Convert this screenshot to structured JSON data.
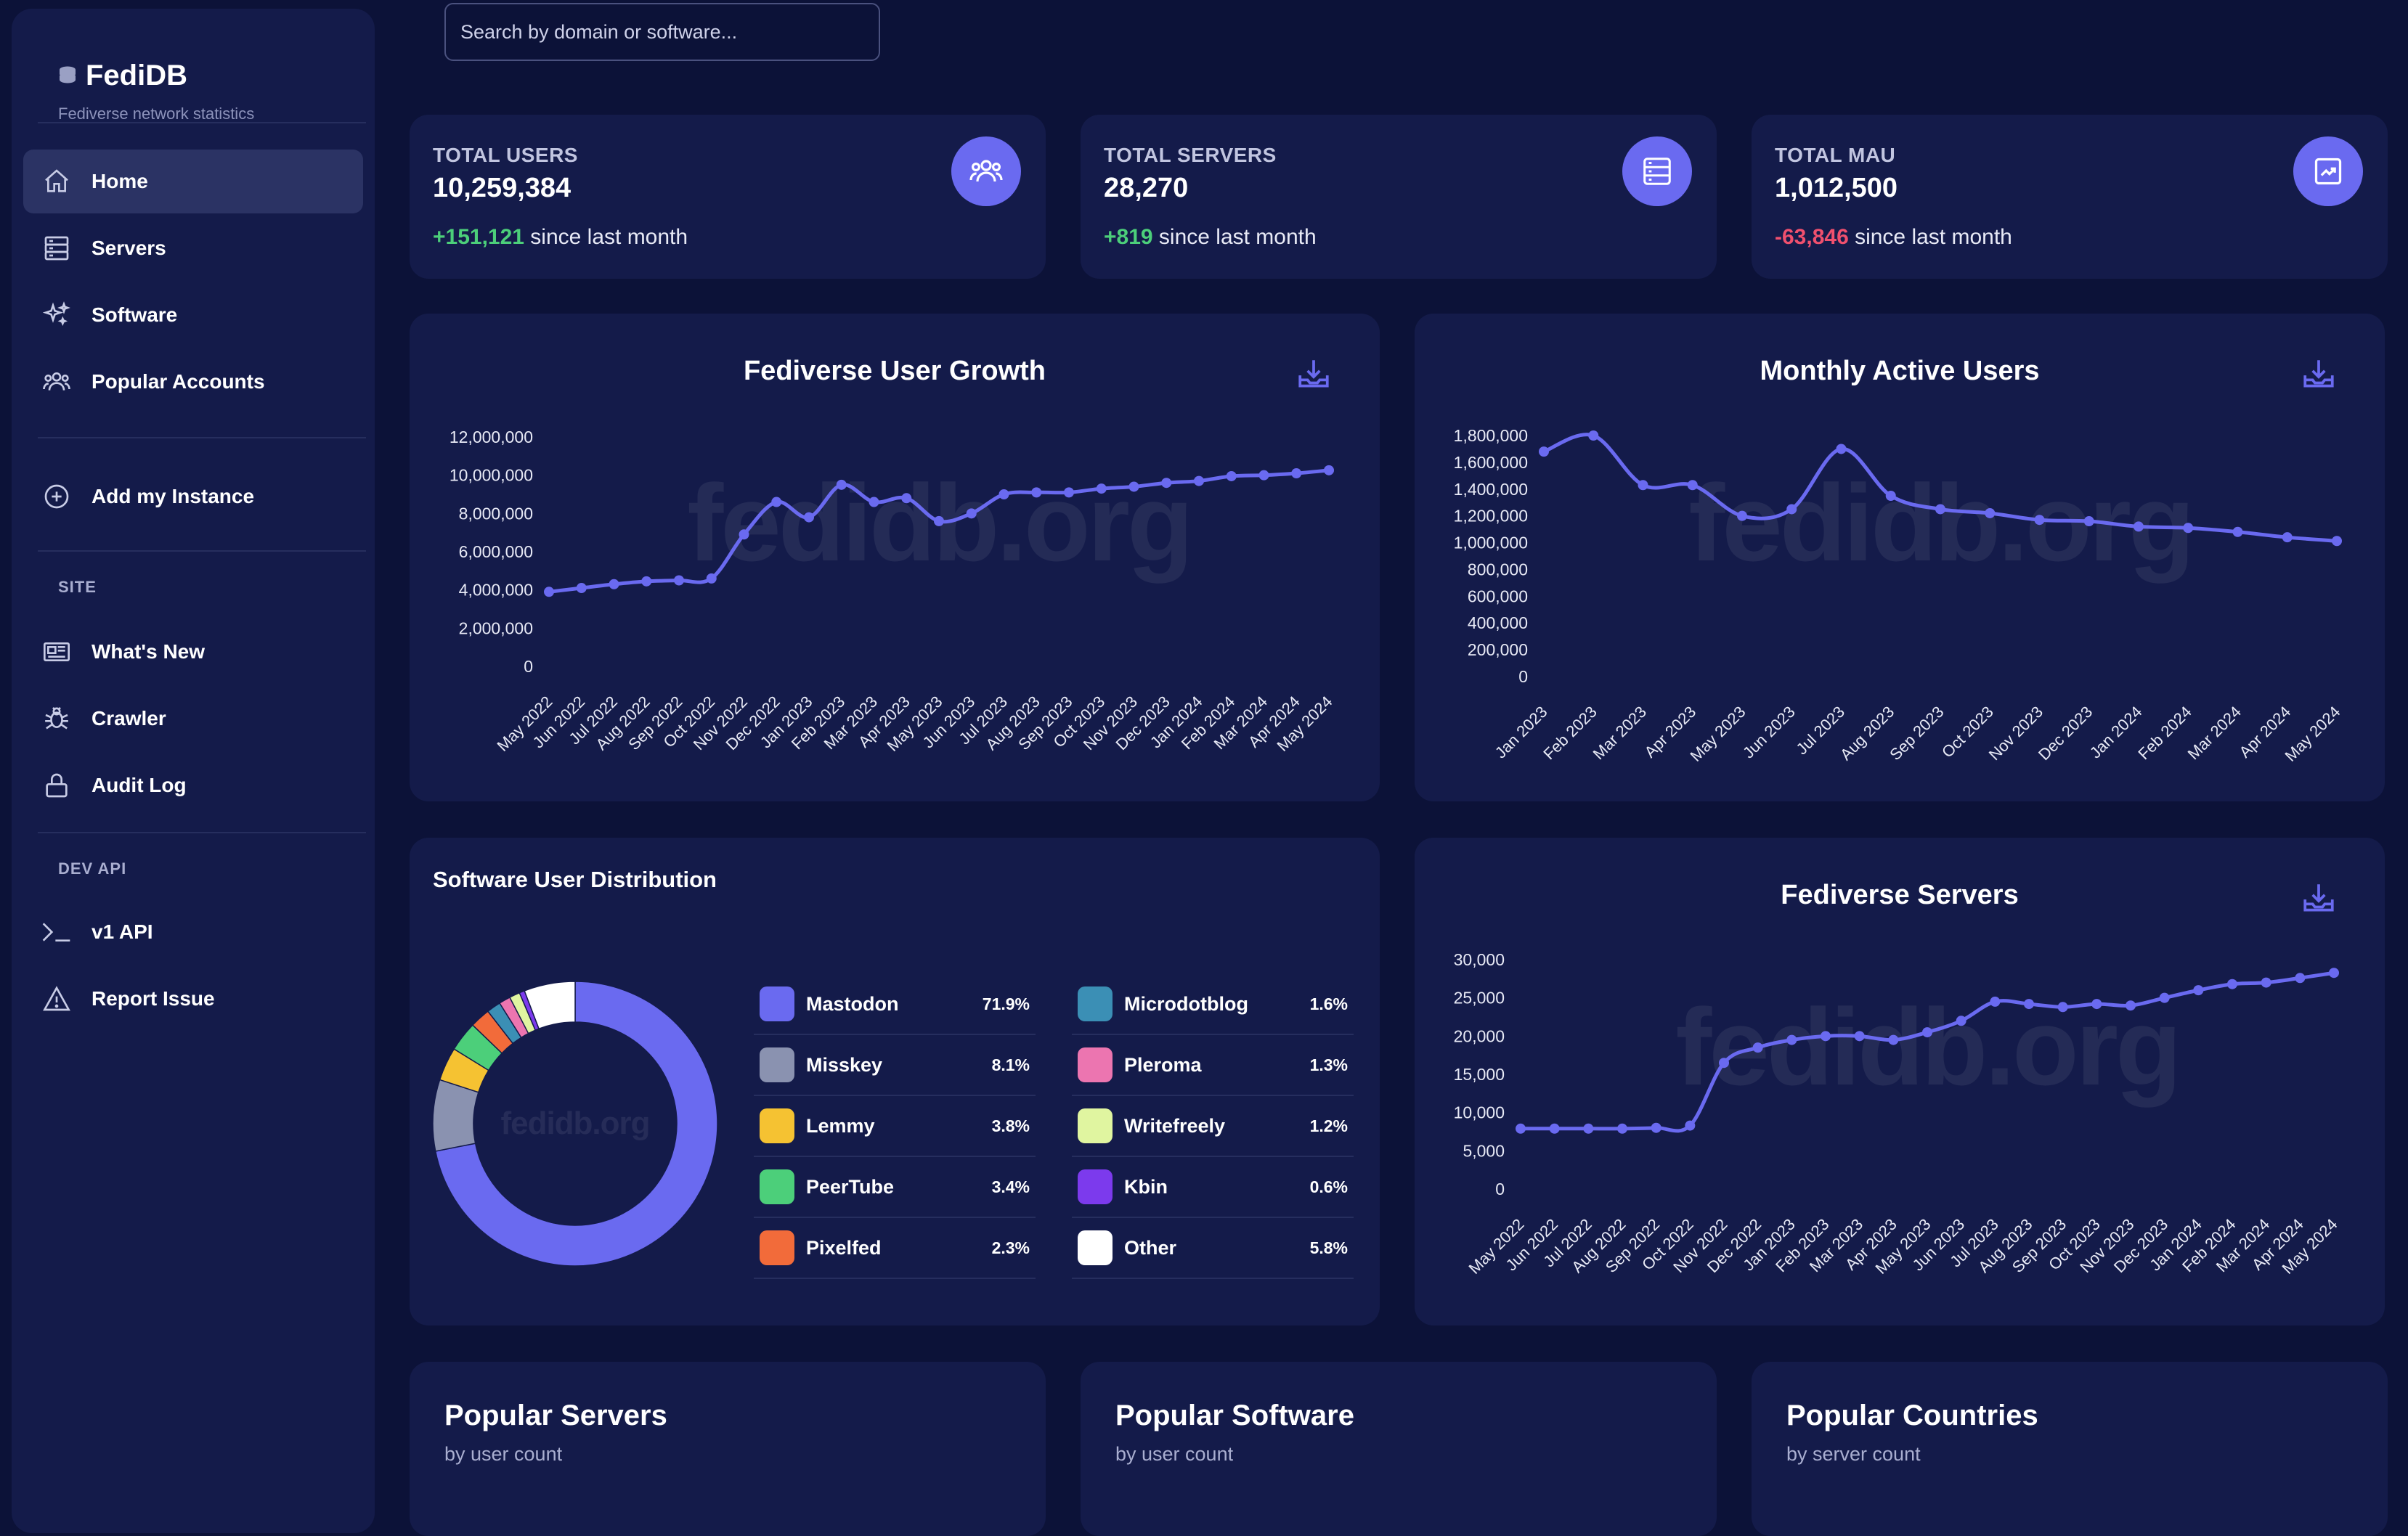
{
  "sidebar": {
    "brand": "FediDB",
    "tagline": "Fediverse network statistics",
    "nav": [
      {
        "label": "Home",
        "icon": "home-icon"
      },
      {
        "label": "Servers",
        "icon": "servers-icon"
      },
      {
        "label": "Software",
        "icon": "sparkles-icon"
      },
      {
        "label": "Popular Accounts",
        "icon": "users-icon"
      }
    ],
    "add_instance": "Add my Instance",
    "site_label": "SITE",
    "site_items": [
      {
        "label": "What's New",
        "icon": "newspaper-icon"
      },
      {
        "label": "Crawler",
        "icon": "bug-icon"
      },
      {
        "label": "Audit Log",
        "icon": "lock-icon"
      }
    ],
    "dev_label": "DEV API",
    "dev_items": [
      {
        "label": "v1 API",
        "icon": "terminal-icon"
      },
      {
        "label": "Report Issue",
        "icon": "warning-icon"
      }
    ]
  },
  "search": {
    "placeholder": "Search by domain or software..."
  },
  "stats": [
    {
      "label": "TOTAL USERS",
      "value": "10,259,384",
      "change": "+151,121",
      "suffix": " since last month",
      "icon": "users-icon"
    },
    {
      "label": "TOTAL SERVERS",
      "value": "28,270",
      "change": "+819",
      "suffix": " since last month",
      "icon": "server-icon"
    },
    {
      "label": "TOTAL MAU",
      "value": "1,012,500",
      "change": "-63,846",
      "suffix": " since last month",
      "icon": "trend-icon"
    }
  ],
  "colors": {
    "accent": "#6a6af0",
    "positive": "#4ccf7a",
    "negative": "#f0506e"
  },
  "watermark": "fedidb.org",
  "chart_data": [
    {
      "type": "line",
      "title": "Fediverse User Growth",
      "x": [
        "May 2022",
        "Jun 2022",
        "Jul 2022",
        "Aug 2022",
        "Sep 2022",
        "Oct 2022",
        "Nov 2022",
        "Dec 2022",
        "Jan 2023",
        "Feb 2023",
        "Mar 2023",
        "Apr 2023",
        "May 2023",
        "Jun 2023",
        "Jul 2023",
        "Aug 2023",
        "Sep 2023",
        "Oct 2023",
        "Nov 2023",
        "Dec 2023",
        "Jan 2024",
        "Feb 2024",
        "Mar 2024",
        "Apr 2024",
        "May 2024"
      ],
      "values": [
        3900000,
        4100000,
        4300000,
        4450000,
        4500000,
        4600000,
        6900000,
        8600000,
        7800000,
        9500000,
        8600000,
        8800000,
        7600000,
        8000000,
        9000000,
        9100000,
        9100000,
        9300000,
        9400000,
        9600000,
        9700000,
        9950000,
        10000000,
        10100000,
        10259384
      ],
      "yticks": [
        "0",
        "2,000,000",
        "4,000,000",
        "6,000,000",
        "8,000,000",
        "10,000,000",
        "12,000,000"
      ],
      "ylim": [
        0,
        12000000
      ],
      "grid": false
    },
    {
      "type": "line",
      "title": "Monthly Active Users",
      "x": [
        "Jan 2023",
        "Feb 2023",
        "Mar 2023",
        "Apr 2023",
        "May 2023",
        "Jun 2023",
        "Jul 2023",
        "Aug 2023",
        "Sep 2023",
        "Oct 2023",
        "Nov 2023",
        "Dec 2023",
        "Jan 2024",
        "Feb 2024",
        "Mar 2024",
        "Apr 2024",
        "May 2024"
      ],
      "values": [
        1680000,
        1800000,
        1430000,
        1430000,
        1200000,
        1250000,
        1700000,
        1350000,
        1250000,
        1220000,
        1170000,
        1160000,
        1120000,
        1110000,
        1080000,
        1040000,
        1012500
      ],
      "yticks": [
        "0",
        "200,000",
        "400,000",
        "600,000",
        "800,000",
        "1,000,000",
        "1,200,000",
        "1,400,000",
        "1,600,000",
        "1,800,000"
      ],
      "ylim": [
        0,
        1800000
      ],
      "grid": false
    },
    {
      "type": "pie",
      "title": "Software User Distribution",
      "categories": [
        "Mastodon",
        "Misskey",
        "Lemmy",
        "PeerTube",
        "Pixelfed",
        "Microdotblog",
        "Pleroma",
        "Writefreely",
        "Kbin",
        "Other"
      ],
      "values": [
        71.9,
        8.1,
        3.8,
        3.4,
        2.3,
        1.6,
        1.3,
        1.2,
        0.6,
        5.8
      ],
      "labels": [
        "71.9%",
        "8.1%",
        "3.8%",
        "3.4%",
        "2.3%",
        "1.6%",
        "1.3%",
        "1.2%",
        "0.6%",
        "5.8%"
      ],
      "colors": [
        "#6a6af0",
        "#8a92b0",
        "#f5c232",
        "#4ccf7a",
        "#f26b3a",
        "#3b8fb5",
        "#ec75b0",
        "#e0f5a0",
        "#7c3aed",
        "#ffffff"
      ]
    },
    {
      "type": "line",
      "title": "Fediverse Servers",
      "x": [
        "May 2022",
        "Jun 2022",
        "Jul 2022",
        "Aug 2022",
        "Sep 2022",
        "Oct 2022",
        "Nov 2022",
        "Dec 2022",
        "Jan 2023",
        "Feb 2023",
        "Mar 2023",
        "Apr 2023",
        "May 2023",
        "Jun 2023",
        "Jul 2023",
        "Aug 2023",
        "Sep 2023",
        "Oct 2023",
        "Nov 2023",
        "Dec 2023",
        "Jan 2024",
        "Feb 2024",
        "Mar 2024",
        "Apr 2024",
        "May 2024"
      ],
      "values": [
        7900,
        7900,
        7900,
        7900,
        8000,
        8300,
        16500,
        18500,
        19500,
        20000,
        20000,
        19500,
        20500,
        22000,
        24500,
        24200,
        23800,
        24200,
        24000,
        25000,
        26000,
        26800,
        27000,
        27600,
        28270
      ],
      "yticks": [
        "0",
        "5,000",
        "10,000",
        "15,000",
        "20,000",
        "25,000",
        "30,000"
      ],
      "ylim": [
        0,
        30000
      ],
      "grid": false
    }
  ],
  "popular": [
    {
      "title": "Popular Servers",
      "sub": "by user count"
    },
    {
      "title": "Popular Software",
      "sub": "by user count"
    },
    {
      "title": "Popular Countries",
      "sub": "by server count"
    }
  ]
}
